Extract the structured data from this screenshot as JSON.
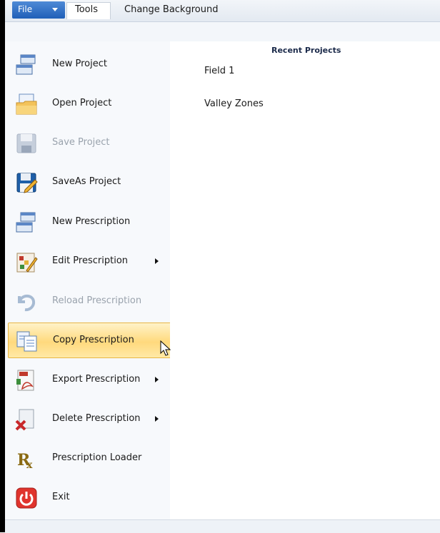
{
  "menubar": {
    "file_label": "File",
    "tabs": [
      "Tools",
      "Change Background"
    ]
  },
  "menu": {
    "items": [
      {
        "label": "New Project",
        "icon": "new-project-icon",
        "enabled": true,
        "submenu": false
      },
      {
        "label": "Open Project",
        "icon": "open-folder-icon",
        "enabled": true,
        "submenu": false
      },
      {
        "label": "Save Project",
        "icon": "save-disk-icon",
        "enabled": false,
        "submenu": false
      },
      {
        "label": "SaveAs Project",
        "icon": "save-as-icon",
        "enabled": true,
        "submenu": false
      },
      {
        "label": "New Prescription",
        "icon": "new-prescription-icon",
        "enabled": true,
        "submenu": false
      },
      {
        "label": "Edit Prescription",
        "icon": "edit-prescription-icon",
        "enabled": true,
        "submenu": true
      },
      {
        "label": "Reload Prescription",
        "icon": "reload-icon",
        "enabled": false,
        "submenu": false
      },
      {
        "label": "Copy Prescription",
        "icon": "copy-icon",
        "enabled": true,
        "submenu": false,
        "highlighted": true
      },
      {
        "label": "Export Prescription",
        "icon": "pdf-export-icon",
        "enabled": true,
        "submenu": true
      },
      {
        "label": "Delete Prescription",
        "icon": "delete-icon",
        "enabled": true,
        "submenu": true
      },
      {
        "label": "Prescription Loader",
        "icon": "rx-icon",
        "enabled": true,
        "submenu": false
      },
      {
        "label": "Exit",
        "icon": "power-icon",
        "enabled": true,
        "submenu": false
      }
    ]
  },
  "recent": {
    "title": "Recent Projects",
    "items": [
      "Field 1",
      "Valley Zones"
    ]
  },
  "colors": {
    "highlight": "#ffd97d",
    "file_button": "#2a6cc4"
  }
}
